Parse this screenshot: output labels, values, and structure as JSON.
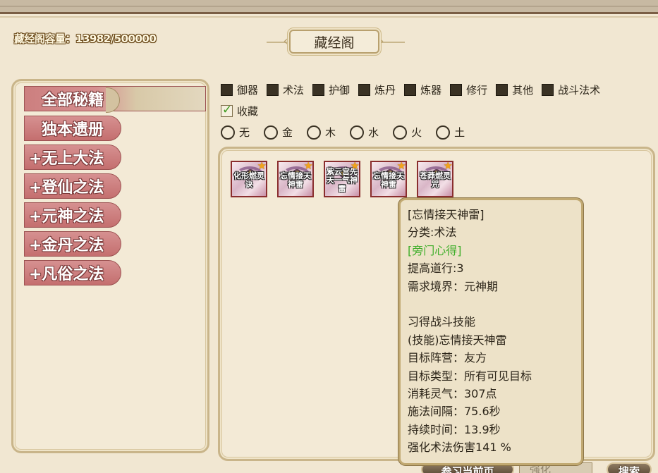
{
  "header": {
    "capacity_text": "藏经阁容量：13982/500000",
    "title": "藏经阁"
  },
  "categories": [
    {
      "label": "全部秘籍"
    },
    {
      "label": "独本遗册"
    },
    {
      "label": "+无上大法"
    },
    {
      "label": "+登仙之法"
    },
    {
      "label": "+元神之法"
    },
    {
      "label": "+金丹之法"
    },
    {
      "label": "+凡俗之法"
    }
  ],
  "filters": {
    "checkboxes": [
      {
        "label": "御器",
        "checked": false
      },
      {
        "label": "术法",
        "checked": false
      },
      {
        "label": "护御",
        "checked": false
      },
      {
        "label": "炼丹",
        "checked": false
      },
      {
        "label": "炼器",
        "checked": false
      },
      {
        "label": "修行",
        "checked": false
      },
      {
        "label": "其他",
        "checked": false
      },
      {
        "label": "战斗法术",
        "checked": false
      }
    ],
    "favorite": {
      "label": "收藏",
      "checked": true
    },
    "elements": [
      {
        "label": "无"
      },
      {
        "label": "金"
      },
      {
        "label": "木"
      },
      {
        "label": "水"
      },
      {
        "label": "火"
      },
      {
        "label": "土"
      }
    ]
  },
  "books": [
    {
      "name": "化形燃灵诀",
      "icon": "scroll-book-icon",
      "favorite": true
    },
    {
      "name": "忘情接天神雷",
      "icon": "scroll-book-icon",
      "favorite": true
    },
    {
      "name": "紫云宫先天一气神雷",
      "icon": "scroll-book-icon",
      "favorite": true
    },
    {
      "name": "忘情接天神雷",
      "icon": "scroll-book-icon",
      "favorite": true
    },
    {
      "name": "苍莽燃灵咒",
      "icon": "scroll-book-icon",
      "favorite": true
    }
  ],
  "tooltip": {
    "lines": [
      {
        "text": "[忘情接天神雷]"
      },
      {
        "text": "分类:术法"
      },
      {
        "text": "[旁门心得]"
      },
      {
        "text": "提高道行:3"
      },
      {
        "text": "需求境界：元神期"
      },
      {
        "text": ""
      },
      {
        "text": "习得战斗技能"
      },
      {
        "text": "(技能)忘情接天神雷"
      },
      {
        "text": "目标阵营：友方"
      },
      {
        "text": "目标类型：所有可见目标"
      },
      {
        "text": "消耗灵气：307点"
      },
      {
        "text": "施法间隔：75.6秒"
      },
      {
        "text": "持续时间：13.9秒"
      },
      {
        "text": "强化术法伤害141 %"
      }
    ]
  },
  "bottom": {
    "button_label": "参习当前页",
    "search_placeholder": "强化",
    "search_button": "搜索"
  },
  "colors": {
    "category_bg": "#c46f6f",
    "tooltip_green": "#3fae2a",
    "star": "#f2a31a"
  }
}
